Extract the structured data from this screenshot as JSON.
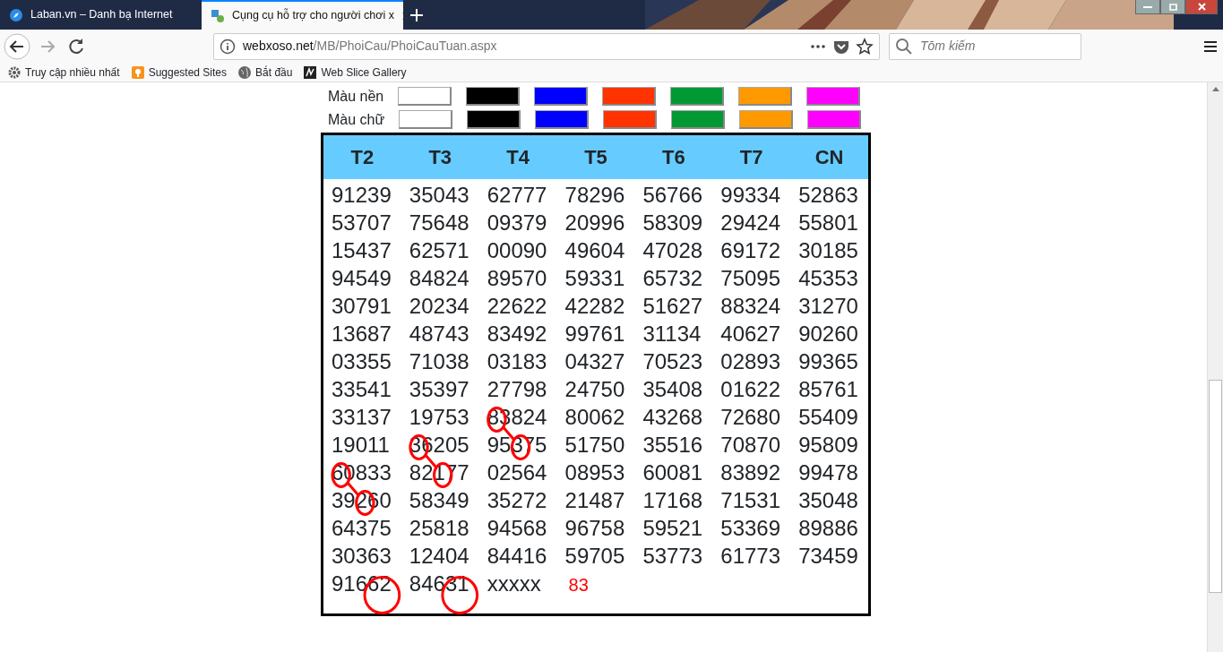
{
  "window": {
    "tabs": [
      {
        "title": "Laban.vn – Danh bạ Internet",
        "selected": false
      },
      {
        "title": "Cụng cụ hỗ trợ cho người chơi x",
        "selected": true
      }
    ]
  },
  "toolbar": {
    "url_host": "webxoso.net",
    "url_path": "/MB/PhoiCau/PhoiCauTuan.aspx",
    "search": {
      "placeholder": "Tōm kiếm"
    }
  },
  "bookmarks": [
    {
      "label": "Truy cập nhiều nhất",
      "kind": "gear"
    },
    {
      "label": "Suggested Sites",
      "kind": "suggested"
    },
    {
      "label": "Bắt đầu",
      "kind": "globe"
    },
    {
      "label": "Web Slice Gallery",
      "kind": "slice"
    }
  ],
  "color_rows": [
    {
      "label": "Màu nền",
      "swatches": [
        {
          "color": "#ffffff"
        },
        {
          "color": "#000000"
        },
        {
          "color": "#0000ff"
        },
        {
          "color": "#ff3300"
        },
        {
          "color": "#009933"
        },
        {
          "color": "#ff9900"
        },
        {
          "color": "#ff00ff"
        }
      ]
    },
    {
      "label": "Màu chữ",
      "swatches": [
        {
          "color": "#ffffff"
        },
        {
          "color": "#000000"
        },
        {
          "color": "#0000ff"
        },
        {
          "color": "#ff3300"
        },
        {
          "color": "#009933"
        },
        {
          "color": "#ff9900"
        },
        {
          "color": "#ff00ff"
        }
      ]
    }
  ],
  "table": {
    "columns": [
      "T2",
      "T3",
      "T4",
      "T5",
      "T6",
      "T7",
      "CN"
    ],
    "rows": [
      [
        "91239",
        "35043",
        "62777",
        "78296",
        "56766",
        "99334",
        "52863"
      ],
      [
        "53707",
        "75648",
        "09379",
        "20996",
        "58309",
        "29424",
        "55801"
      ],
      [
        "15437",
        "62571",
        "00090",
        "49604",
        "47028",
        "69172",
        "30185"
      ],
      [
        "94549",
        "84824",
        "89570",
        "59331",
        "65732",
        "75095",
        "45353"
      ],
      [
        "30791",
        "20234",
        "22622",
        "42282",
        "51627",
        "88324",
        "31270"
      ],
      [
        "13687",
        "48743",
        "83492",
        "99761",
        "31134",
        "40627",
        "90260"
      ],
      [
        "03355",
        "71038",
        "03183",
        "04327",
        "70523",
        "02893",
        "99365"
      ],
      [
        "33541",
        "35397",
        "27798",
        "24750",
        "35408",
        "01622",
        "85761"
      ],
      [
        "33137",
        "19753",
        {
          "circled": "8",
          "post": "3824",
          "kind": "ring",
          "linked_below": true
        },
        "80062",
        "43268",
        "72680",
        "55409"
      ],
      [
        "19011",
        {
          "circled": "3",
          "post": "6205",
          "kind": "ring",
          "linked_below": true
        },
        {
          "pre": "95",
          "circled": "3",
          "post": "75",
          "kind": "ring"
        },
        "51750",
        "35516",
        "70870",
        "95809"
      ],
      [
        {
          "circled": "6",
          "post": "0833",
          "kind": "ring",
          "linked_below": true
        },
        {
          "pre": "82",
          "circled": "1",
          "post": "77",
          "kind": "ring"
        },
        "02564",
        "08953",
        "60081",
        "83892",
        "99478"
      ],
      [
        {
          "pre": "39",
          "circled": "2",
          "post": "60",
          "kind": "ring"
        },
        "58349",
        "35272",
        "21487",
        "17168",
        "71531",
        "35048"
      ],
      [
        "64375",
        "25818",
        "94568",
        "96758",
        "59521",
        "53369",
        "89886"
      ],
      [
        "30363",
        "12404",
        "84416",
        "59705",
        "53773",
        "61773",
        "73459"
      ],
      [
        {
          "pre": "916",
          "circled": "62",
          "kind": "bigring"
        },
        {
          "pre": "846",
          "circled": "31",
          "kind": "bigring"
        },
        "xxxxx"
      ]
    ],
    "result": "83"
  }
}
